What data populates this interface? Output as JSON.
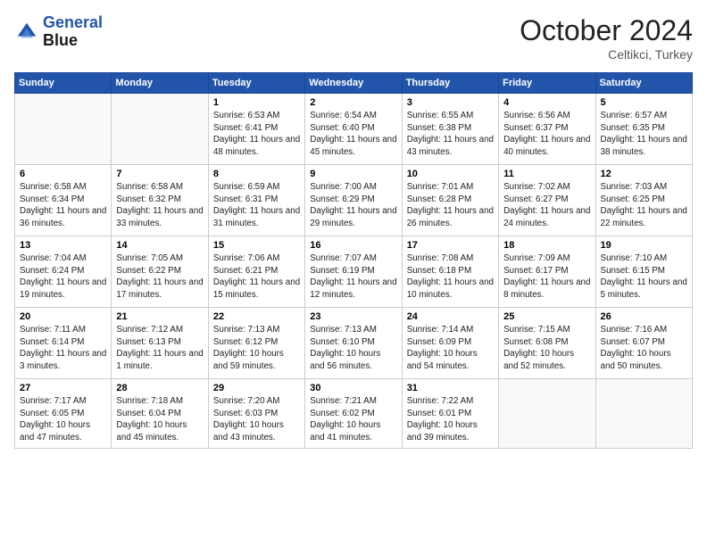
{
  "header": {
    "logo_line1": "General",
    "logo_line2": "Blue",
    "month": "October 2024",
    "location": "Celtikci, Turkey"
  },
  "days_of_week": [
    "Sunday",
    "Monday",
    "Tuesday",
    "Wednesday",
    "Thursday",
    "Friday",
    "Saturday"
  ],
  "weeks": [
    [
      {
        "day": "",
        "info": ""
      },
      {
        "day": "",
        "info": ""
      },
      {
        "day": "1",
        "info": "Sunrise: 6:53 AM\nSunset: 6:41 PM\nDaylight: 11 hours and 48 minutes."
      },
      {
        "day": "2",
        "info": "Sunrise: 6:54 AM\nSunset: 6:40 PM\nDaylight: 11 hours and 45 minutes."
      },
      {
        "day": "3",
        "info": "Sunrise: 6:55 AM\nSunset: 6:38 PM\nDaylight: 11 hours and 43 minutes."
      },
      {
        "day": "4",
        "info": "Sunrise: 6:56 AM\nSunset: 6:37 PM\nDaylight: 11 hours and 40 minutes."
      },
      {
        "day": "5",
        "info": "Sunrise: 6:57 AM\nSunset: 6:35 PM\nDaylight: 11 hours and 38 minutes."
      }
    ],
    [
      {
        "day": "6",
        "info": "Sunrise: 6:58 AM\nSunset: 6:34 PM\nDaylight: 11 hours and 36 minutes."
      },
      {
        "day": "7",
        "info": "Sunrise: 6:58 AM\nSunset: 6:32 PM\nDaylight: 11 hours and 33 minutes."
      },
      {
        "day": "8",
        "info": "Sunrise: 6:59 AM\nSunset: 6:31 PM\nDaylight: 11 hours and 31 minutes."
      },
      {
        "day": "9",
        "info": "Sunrise: 7:00 AM\nSunset: 6:29 PM\nDaylight: 11 hours and 29 minutes."
      },
      {
        "day": "10",
        "info": "Sunrise: 7:01 AM\nSunset: 6:28 PM\nDaylight: 11 hours and 26 minutes."
      },
      {
        "day": "11",
        "info": "Sunrise: 7:02 AM\nSunset: 6:27 PM\nDaylight: 11 hours and 24 minutes."
      },
      {
        "day": "12",
        "info": "Sunrise: 7:03 AM\nSunset: 6:25 PM\nDaylight: 11 hours and 22 minutes."
      }
    ],
    [
      {
        "day": "13",
        "info": "Sunrise: 7:04 AM\nSunset: 6:24 PM\nDaylight: 11 hours and 19 minutes."
      },
      {
        "day": "14",
        "info": "Sunrise: 7:05 AM\nSunset: 6:22 PM\nDaylight: 11 hours and 17 minutes."
      },
      {
        "day": "15",
        "info": "Sunrise: 7:06 AM\nSunset: 6:21 PM\nDaylight: 11 hours and 15 minutes."
      },
      {
        "day": "16",
        "info": "Sunrise: 7:07 AM\nSunset: 6:19 PM\nDaylight: 11 hours and 12 minutes."
      },
      {
        "day": "17",
        "info": "Sunrise: 7:08 AM\nSunset: 6:18 PM\nDaylight: 11 hours and 10 minutes."
      },
      {
        "day": "18",
        "info": "Sunrise: 7:09 AM\nSunset: 6:17 PM\nDaylight: 11 hours and 8 minutes."
      },
      {
        "day": "19",
        "info": "Sunrise: 7:10 AM\nSunset: 6:15 PM\nDaylight: 11 hours and 5 minutes."
      }
    ],
    [
      {
        "day": "20",
        "info": "Sunrise: 7:11 AM\nSunset: 6:14 PM\nDaylight: 11 hours and 3 minutes."
      },
      {
        "day": "21",
        "info": "Sunrise: 7:12 AM\nSunset: 6:13 PM\nDaylight: 11 hours and 1 minute."
      },
      {
        "day": "22",
        "info": "Sunrise: 7:13 AM\nSunset: 6:12 PM\nDaylight: 10 hours and 59 minutes."
      },
      {
        "day": "23",
        "info": "Sunrise: 7:13 AM\nSunset: 6:10 PM\nDaylight: 10 hours and 56 minutes."
      },
      {
        "day": "24",
        "info": "Sunrise: 7:14 AM\nSunset: 6:09 PM\nDaylight: 10 hours and 54 minutes."
      },
      {
        "day": "25",
        "info": "Sunrise: 7:15 AM\nSunset: 6:08 PM\nDaylight: 10 hours and 52 minutes."
      },
      {
        "day": "26",
        "info": "Sunrise: 7:16 AM\nSunset: 6:07 PM\nDaylight: 10 hours and 50 minutes."
      }
    ],
    [
      {
        "day": "27",
        "info": "Sunrise: 7:17 AM\nSunset: 6:05 PM\nDaylight: 10 hours and 47 minutes."
      },
      {
        "day": "28",
        "info": "Sunrise: 7:18 AM\nSunset: 6:04 PM\nDaylight: 10 hours and 45 minutes."
      },
      {
        "day": "29",
        "info": "Sunrise: 7:20 AM\nSunset: 6:03 PM\nDaylight: 10 hours and 43 minutes."
      },
      {
        "day": "30",
        "info": "Sunrise: 7:21 AM\nSunset: 6:02 PM\nDaylight: 10 hours and 41 minutes."
      },
      {
        "day": "31",
        "info": "Sunrise: 7:22 AM\nSunset: 6:01 PM\nDaylight: 10 hours and 39 minutes."
      },
      {
        "day": "",
        "info": ""
      },
      {
        "day": "",
        "info": ""
      }
    ]
  ]
}
